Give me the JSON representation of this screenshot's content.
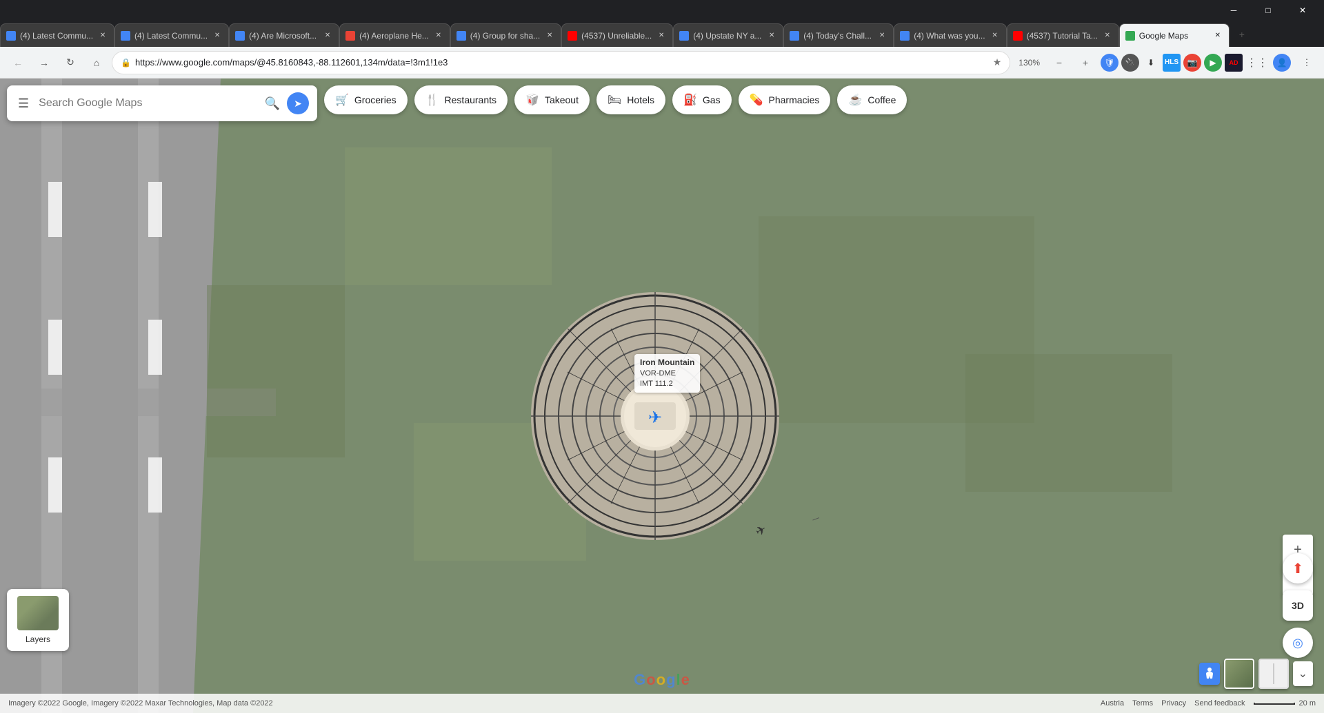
{
  "window": {
    "title": "Google Maps",
    "title_bar_buttons": [
      "minimize",
      "maximize",
      "close"
    ]
  },
  "tabs": [
    {
      "id": "tab1",
      "title": "(4) Latest Commu...",
      "favicon_color": "#4285f4",
      "active": false
    },
    {
      "id": "tab2",
      "title": "(4) Latest Commu...",
      "favicon_color": "#4285f4",
      "active": false
    },
    {
      "id": "tab3",
      "title": "(4) Are Microsoft...",
      "favicon_color": "#4285f4",
      "active": false
    },
    {
      "id": "tab4",
      "title": "(4) Aeroplane He...",
      "favicon_color": "#ea4335",
      "active": false
    },
    {
      "id": "tab5",
      "title": "(4) Group for sha...",
      "favicon_color": "#4285f4",
      "active": false
    },
    {
      "id": "tab6",
      "title": "(4537) Unreliable...",
      "favicon_color": "#ff0000",
      "active": false
    },
    {
      "id": "tab7",
      "title": "(4) Upstate NY a...",
      "favicon_color": "#4285f4",
      "active": false
    },
    {
      "id": "tab8",
      "title": "(4) Today's Chall...",
      "favicon_color": "#4285f4",
      "active": false
    },
    {
      "id": "tab9",
      "title": "(4) What was you...",
      "favicon_color": "#4285f4",
      "active": false
    },
    {
      "id": "tab10",
      "title": "(4537) Tutorial Ta...",
      "favicon_color": "#ff0000",
      "active": false
    },
    {
      "id": "tab11",
      "title": "Google Maps",
      "favicon_color": "#34a853",
      "active": true
    }
  ],
  "toolbar": {
    "back_label": "←",
    "forward_label": "→",
    "reload_label": "↻",
    "home_label": "⌂",
    "address": "https://www.google.com/maps/@45.8160843,-88.112601,134m/data=!3m1!1e3",
    "zoom_level": "130%",
    "bookmark_icon": "★",
    "profile_icon": "👤"
  },
  "maps": {
    "search_placeholder": "Search Google Maps",
    "categories": [
      {
        "id": "groceries",
        "label": "Groceries",
        "icon": "🛒"
      },
      {
        "id": "restaurants",
        "label": "Restaurants",
        "icon": "🍴"
      },
      {
        "id": "takeout",
        "label": "Takeout",
        "icon": "🥡"
      },
      {
        "id": "hotels",
        "label": "Hotels",
        "icon": "🛏"
      },
      {
        "id": "gas",
        "label": "Gas",
        "icon": "⛽"
      },
      {
        "id": "pharmacies",
        "label": "Pharmacies",
        "icon": "💊"
      },
      {
        "id": "coffee",
        "label": "Coffee",
        "icon": "☕"
      }
    ],
    "poi": {
      "name": "Iron Mountain VOR-DME",
      "freq": "IMT 111.2",
      "marker_icon": "✈"
    },
    "layers_label": "Layers",
    "google_logo": "Google",
    "bottom_info": "Imagery ©2022 Google, Imagery ©2022 Maxar Technologies, Map data ©2022",
    "attribution_links": [
      "Austria",
      "Terms",
      "Privacy",
      "Send feedback"
    ],
    "scale_label": "20 m",
    "zoom_plus": "+",
    "zoom_minus": "−",
    "control_3d": "3D"
  }
}
